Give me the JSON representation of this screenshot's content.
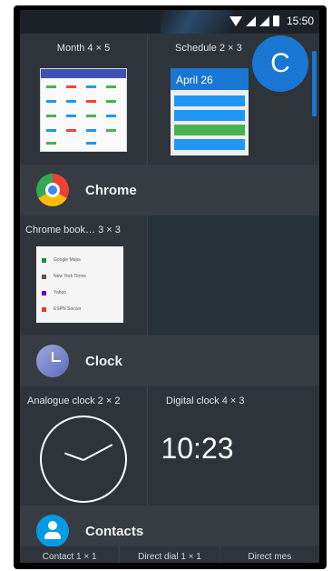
{
  "status_bar": {
    "time": "15:50"
  },
  "widgets_row1": [
    {
      "title": "Month 4 × 5"
    },
    {
      "title": "Schedule 2 × 3",
      "preview_date": "April 26"
    }
  ],
  "avatar_letter": "C",
  "apps": {
    "chrome": {
      "label": "Chrome",
      "widget_title": "Chrome book… 3 × 3",
      "bookmarks": [
        {
          "label": "Google Maps",
          "color": "#1e8e3e"
        },
        {
          "label": "New York Times",
          "color": "#555555"
        },
        {
          "label": "Yahoo",
          "color": "#5f01d1"
        },
        {
          "label": "ESPN Soccer",
          "color": "#e53935"
        }
      ]
    },
    "clock": {
      "label": "Clock",
      "widgets": [
        {
          "title": "Analogue clock 2 × 2"
        },
        {
          "title": "Digital clock 4 × 3",
          "time": "10:23"
        }
      ]
    },
    "contacts": {
      "label": "Contacts",
      "widgets": [
        "Contact 1 × 1",
        "Direct dial 1 × 1",
        "Direct mes"
      ]
    }
  },
  "colors": {
    "accent": "#1976d2",
    "panel": "#2e3439",
    "header": "#363c42"
  }
}
